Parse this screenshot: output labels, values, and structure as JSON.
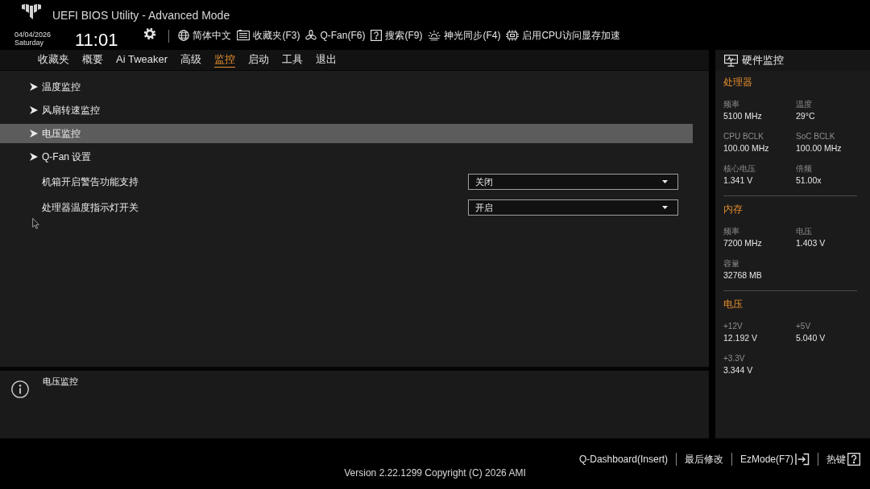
{
  "header": {
    "title": "UEFI BIOS Utility - Advanced Mode",
    "date": "04/04/2026",
    "weekday": "Saturday",
    "time": "11:01"
  },
  "toolbar": [
    {
      "kind": "language",
      "label": "简体中文"
    },
    {
      "kind": "favorites",
      "label": "收藏夹(F3)"
    },
    {
      "kind": "qfan",
      "label": "Q-Fan(F6)"
    },
    {
      "kind": "search",
      "label": "搜索(F9)"
    },
    {
      "kind": "lighting",
      "label": "神光同步(F4)"
    },
    {
      "kind": "chip",
      "label": "启用CPU访问显存加速"
    }
  ],
  "tabs": [
    {
      "label": "收藏夹",
      "selected": false
    },
    {
      "label": "概要",
      "selected": false
    },
    {
      "label": "Ai Tweaker",
      "selected": false
    },
    {
      "label": "高级",
      "selected": false
    },
    {
      "label": "监控",
      "selected": true
    },
    {
      "label": "启动",
      "selected": false
    },
    {
      "label": "工具",
      "selected": false
    },
    {
      "label": "退出",
      "selected": false
    }
  ],
  "menu": [
    {
      "kind": "submenu",
      "label": "温度监控",
      "selected": false
    },
    {
      "kind": "submenu",
      "label": "风扇转速监控",
      "selected": false
    },
    {
      "kind": "submenu",
      "label": "电压监控",
      "selected": true
    },
    {
      "kind": "submenu",
      "label": "Q-Fan 设置",
      "selected": false
    },
    {
      "kind": "dropdown",
      "label": "机箱开启警告功能支持",
      "value": "关闭",
      "selected": false
    },
    {
      "kind": "dropdown",
      "label": "处理器温度指示灯开关",
      "value": "开启",
      "selected": false
    }
  ],
  "help": {
    "text": "电压监控"
  },
  "hardware_monitor": {
    "title": "硬件监控",
    "sections": [
      {
        "title": "处理器",
        "readings": [
          {
            "label": "频率",
            "value": "5100 MHz"
          },
          {
            "label": "温度",
            "value": "29°C"
          },
          {
            "label": "CPU BCLK",
            "value": "100.00 MHz"
          },
          {
            "label": "SoC BCLK",
            "value": "100.00 MHz"
          },
          {
            "label": "核心电压",
            "value": "1.341 V"
          },
          {
            "label": "倍频",
            "value": "51.00x"
          }
        ]
      },
      {
        "title": "内存",
        "readings": [
          {
            "label": "频率",
            "value": "7200 MHz"
          },
          {
            "label": "电压",
            "value": "1.403 V"
          },
          {
            "label": "容量",
            "value": "32768 MB"
          }
        ]
      },
      {
        "title": "电压",
        "readings": [
          {
            "label": "+12V",
            "value": "12.192 V"
          },
          {
            "label": "+5V",
            "value": "5.040 V"
          },
          {
            "label": "+3.3V",
            "value": "3.344 V"
          }
        ]
      }
    ]
  },
  "footer": {
    "actions": [
      {
        "kind": "plain",
        "label": "Q-Dashboard(Insert)"
      },
      {
        "kind": "plain",
        "label": "最后修改"
      },
      {
        "kind": "exit",
        "label": "EzMode(F7)"
      },
      {
        "kind": "help",
        "label": "热键"
      }
    ],
    "version": "Version 2.22.1299 Copyright (C) 2026 AMI"
  }
}
